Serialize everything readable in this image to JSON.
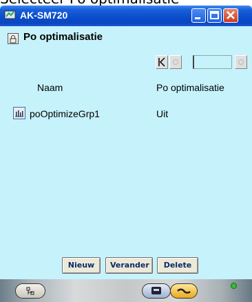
{
  "caption": "Selecteer Po optimalisatie",
  "window": {
    "title": "AK-SM720"
  },
  "header": {
    "title": "Po optimalisatie"
  },
  "pager": {
    "first": "K",
    "page_value": ""
  },
  "table": {
    "columns": [
      "Naam",
      "Po optimalisatie"
    ],
    "rows": [
      {
        "name": "poOptimizeGrp1",
        "value": "Uit",
        "icon": "chart-icon"
      }
    ]
  },
  "actions": {
    "new": "Nieuw",
    "edit": "Verander",
    "delete": "Delete"
  },
  "toolbar": {
    "icons": [
      "network-icon",
      "screen-icon",
      "gauge-icon"
    ],
    "status_color": "#2fc02f"
  },
  "colors": {
    "background": "#c6f2fb",
    "titlebar": "#0b4ccc",
    "button_text": "#0b2a66"
  }
}
